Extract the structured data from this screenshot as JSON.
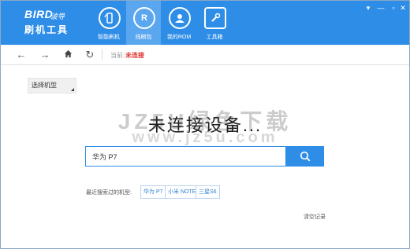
{
  "header": {
    "logo_brand": "BIRD",
    "logo_sub": "波导",
    "logo_title": "刷机工具",
    "nav": [
      {
        "label": "智能刷机",
        "icon": "phone-refresh-icon"
      },
      {
        "label": "线刷包",
        "icon": "package-icon"
      },
      {
        "label": "我的ROM",
        "icon": "user-icon"
      },
      {
        "label": "工具箱",
        "icon": "wrench-icon"
      }
    ],
    "nav_active_index": 1,
    "nav_package_glyph": "R"
  },
  "toolbar": {
    "status_label": "当前:",
    "status_value": "未连接"
  },
  "main": {
    "model_select_label": "选择机型",
    "connect_message": "未连接设备...",
    "search_value": "华为 P7",
    "recent_label": "最近搜索过的机型:",
    "recent": [
      "华为 P7",
      "小米 NOTE",
      "三星S6"
    ],
    "clear_label": "清空记录"
  },
  "watermark": {
    "line1": "JZ5U绿色下载",
    "line2": "www.jz5u.com"
  },
  "colors": {
    "brand": "#2e8de7",
    "status_red": "#e03030"
  }
}
